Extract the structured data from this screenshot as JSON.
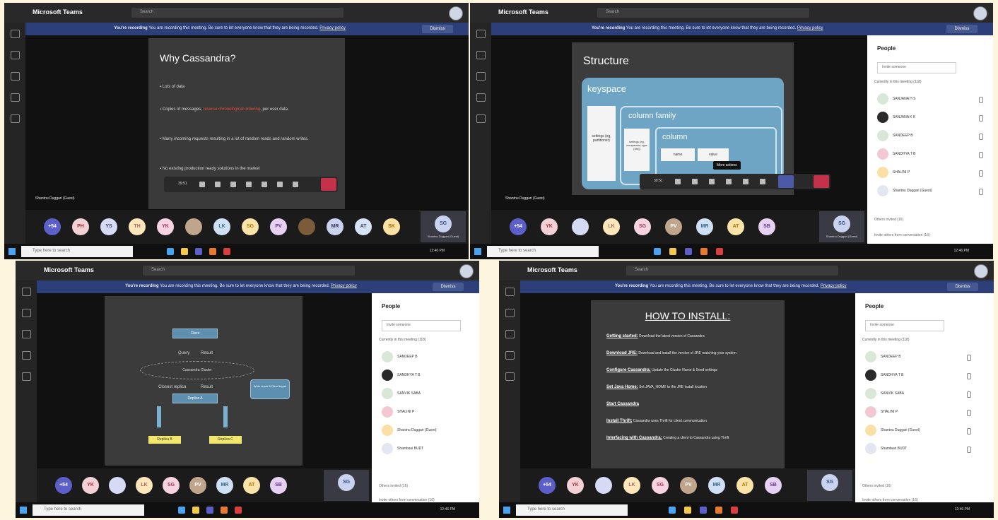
{
  "app_title": "Microsoft Teams",
  "search_placeholder": "Search",
  "recording": {
    "bold": "You're recording",
    "text": "You are recording this meeting. Be sure to let everyone know that they are being recorded.",
    "link": "Privacy policy",
    "dismiss": "Dismiss"
  },
  "presenter_name": "Shantnu Duggari (Guest)",
  "call_time": "39:51",
  "slide1": {
    "title": "Why Cassandra?",
    "bullets": [
      {
        "pre": "Lots of data",
        "red": "",
        "post": ""
      },
      {
        "pre": "Copies of messages, ",
        "red": "reverse chronological ordering",
        "post": ", per user data."
      },
      {
        "pre": "Many incoming requests resulting in a lot of random reads and random writes.",
        "red": "",
        "post": ""
      },
      {
        "pre": "No existing production ready solutions in the market",
        "red": "",
        "post": ""
      }
    ]
  },
  "slide2": {
    "title": "Structure",
    "keyspace": "keyspace",
    "column_family": "column family",
    "column": "column",
    "settings1": "settings (eg, partitioner)",
    "settings2": "settings (eg, comparator, type [Std])",
    "name": "name",
    "value": "value",
    "more_actions": "More actions"
  },
  "slide3": {
    "client": "Client",
    "query": "Query",
    "result": "Result",
    "cluster": "Cassandra Cluster",
    "closest": "Closest replica",
    "result2": "Result",
    "replica_a": "Replica A",
    "replica_b": "Replica B",
    "replica_c": "Replica C",
    "note": "Write repair & Read repair"
  },
  "slide4": {
    "title": "HOW TO INSTALL:",
    "items": [
      {
        "head": "Getting started:",
        "text": "Download the latest version of Cassandra"
      },
      {
        "head": "Download JRE:",
        "text": "Download and install the version of JRE matching your system"
      },
      {
        "head": "Configure Cassandra:",
        "text": "Update the Cluster Name & Seed settings"
      },
      {
        "head": "Set Java Home:",
        "text": "Set JAVA_HOME to the JRE install location"
      },
      {
        "head": "Start Cassandra",
        "text": ""
      },
      {
        "head": "Install Thrift:",
        "text": "Cassandra uses Thrift for client communication"
      },
      {
        "head": "Interfacing with Cassandra:",
        "text": "Creating a client to Cassandra using Thrift"
      }
    ]
  },
  "participants1": [
    "+54",
    "PH",
    "YS",
    "TH",
    "YK",
    "",
    "LK",
    "SG",
    "PV",
    "",
    "MR",
    "AT",
    "SK"
  ],
  "participants2": [
    "+54",
    "YK",
    "",
    "LK",
    "SG",
    "PV",
    "MR",
    "AT",
    "SB"
  ],
  "self_initials": "SG",
  "people": {
    "title": "People",
    "invite": "Invite someone",
    "current": "Currently in this meeting (118)",
    "view_all": "View all",
    "others_invited": "Others invited (16)",
    "invite_conv": "Invite others from conversation (16)",
    "list_a": [
      "SANJANA H S",
      "SANJANA K K",
      "SANDEEP B",
      "SANDHYA T B",
      "SHALINI P",
      "Shantnu Duggari (Guest)"
    ],
    "list_b": [
      "SANDEEP B",
      "SANDHYA T B",
      "SANVIK SABA",
      "SHALINI P",
      "Shantnu Duggari (Guest)",
      "Shambavi BUDT"
    ],
    "guest_sub": "Guest"
  },
  "taskbar": {
    "search": "Type here to search",
    "time": "12:46 PM"
  },
  "colors": {
    "accent": "#2d3f78",
    "hangup": "#c4314b"
  }
}
